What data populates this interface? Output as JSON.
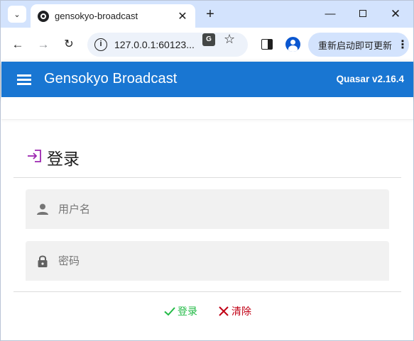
{
  "browser": {
    "tab_title": "gensokyo-broadcast",
    "tab_close": "✕",
    "new_tab": "+",
    "window_controls": {
      "minimize": "—",
      "close": "✕"
    },
    "url": "127.0.0.1:60123...",
    "translate_badge": "G",
    "update_button_label": "重新启动即可更新",
    "update_menu": "⋮"
  },
  "app": {
    "title": "Gensokyo Broadcast",
    "version": "Quasar v2.16.4"
  },
  "login_card": {
    "title": "登录",
    "username_placeholder": "用户名",
    "password_placeholder": "密码",
    "login_button": "登录",
    "clear_button": "清除"
  },
  "colors": {
    "header_bg": "#1976d2",
    "login_icon": "#9c27b0",
    "login_button": "#21ba45",
    "clear_button": "#c10015",
    "tabstrip_bg": "#d3e3fd"
  }
}
